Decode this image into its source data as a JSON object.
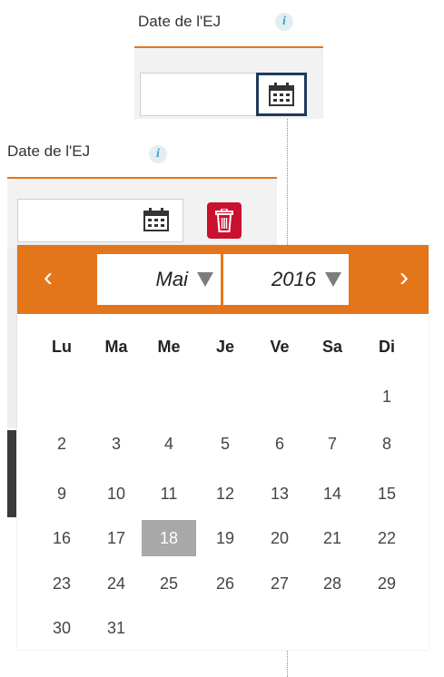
{
  "first_field": {
    "label": "Date de l'EJ",
    "info_icon": "i",
    "value": ""
  },
  "second_field": {
    "label": "Date de l'EJ",
    "info_icon": "i",
    "value": ""
  },
  "calendar": {
    "prev": "‹",
    "next": "›",
    "month": "Mai",
    "year": "2016",
    "weekdays": [
      "Lu",
      "Ma",
      "Me",
      "Je",
      "Ve",
      "Sa",
      "Di"
    ],
    "weeks": [
      [
        "",
        "",
        "",
        "",
        "",
        "",
        "1"
      ],
      [
        "2",
        "3",
        "4",
        "5",
        "6",
        "7",
        "8"
      ],
      [
        "9",
        "10",
        "11",
        "12",
        "13",
        "14",
        "15"
      ],
      [
        "16",
        "17",
        "18",
        "19",
        "20",
        "21",
        "22"
      ],
      [
        "23",
        "24",
        "25",
        "26",
        "27",
        "28",
        "29"
      ],
      [
        "30",
        "31",
        "",
        "",
        "",
        "",
        ""
      ]
    ],
    "selected_day": "18"
  },
  "colors": {
    "accent": "#e3761b",
    "delete": "#c9102e",
    "focus_border": "#1f3a5c",
    "selected_day": "#a8a8a8"
  }
}
